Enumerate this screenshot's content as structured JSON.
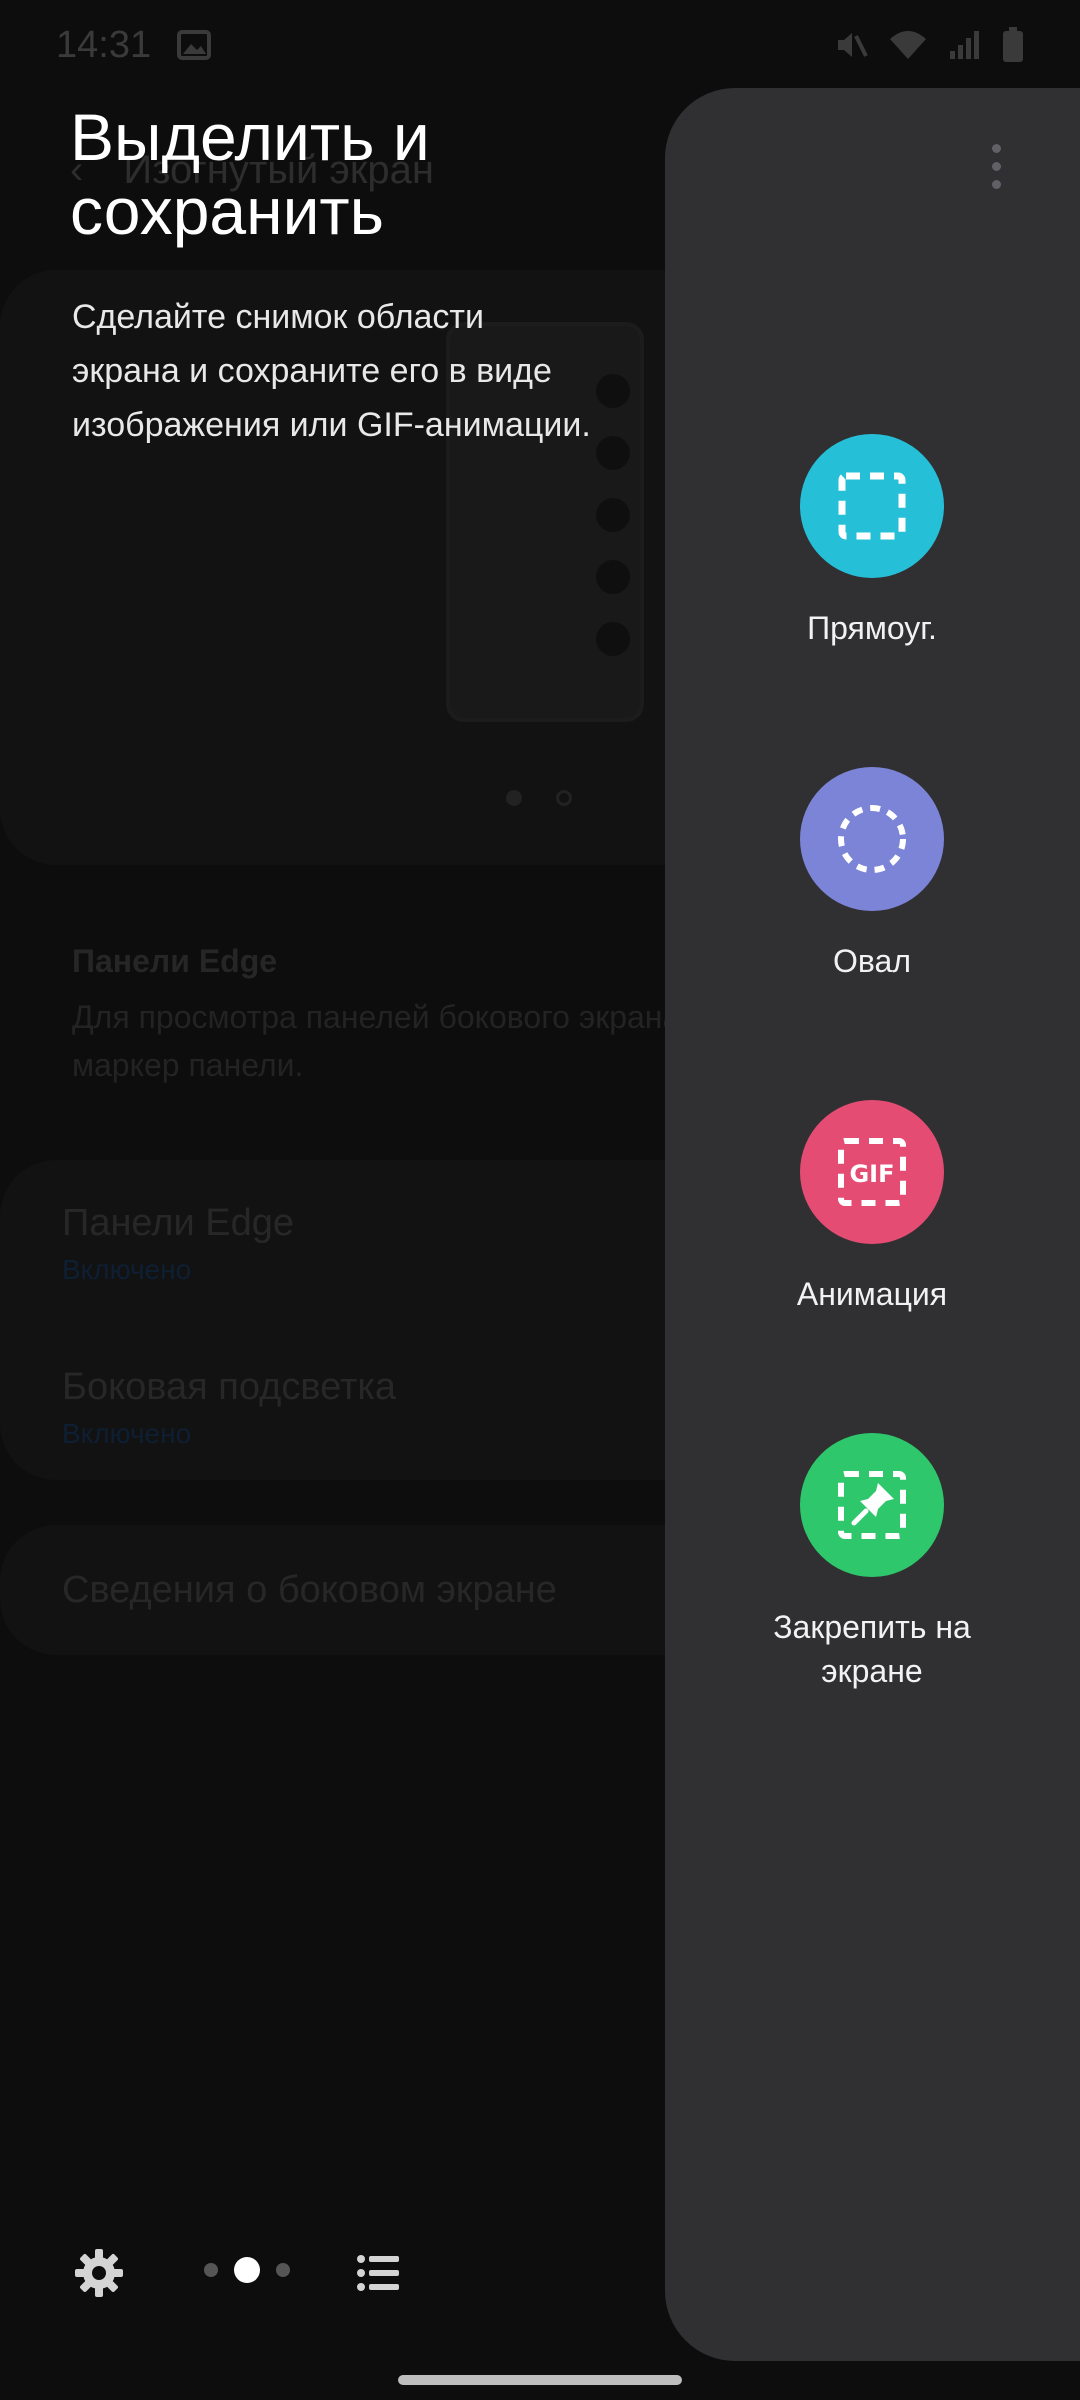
{
  "status_bar": {
    "time": "14:31"
  },
  "background": {
    "header_title": "Изогнутый экран",
    "section_title": "Панели Edge",
    "section_desc": "Для просмотра панелей бокового экрана перетащите маркер панели.",
    "items": [
      {
        "label": "Панели Edge",
        "sub": "Включено"
      },
      {
        "label": "Боковая подсветка",
        "sub": "Включено"
      }
    ],
    "info_label": "Сведения о боковом экране"
  },
  "panel_info": {
    "title": "Выделить и сохранить",
    "description": "Сделайте снимок области экрана и сохраните его в виде изображения или GIF-анимации."
  },
  "tools": [
    {
      "label": "Прямоуг.",
      "color": "#26bfd8",
      "icon": "rectangle-select-icon"
    },
    {
      "label": "Овал",
      "color": "#7b84d6",
      "icon": "oval-select-icon"
    },
    {
      "label": "Анимация",
      "color": "#e54c73",
      "icon": "gif-icon",
      "icon_text": "GIF"
    },
    {
      "label": "Закрепить на экране",
      "color": "#2fc76c",
      "icon": "pin-icon"
    }
  ]
}
